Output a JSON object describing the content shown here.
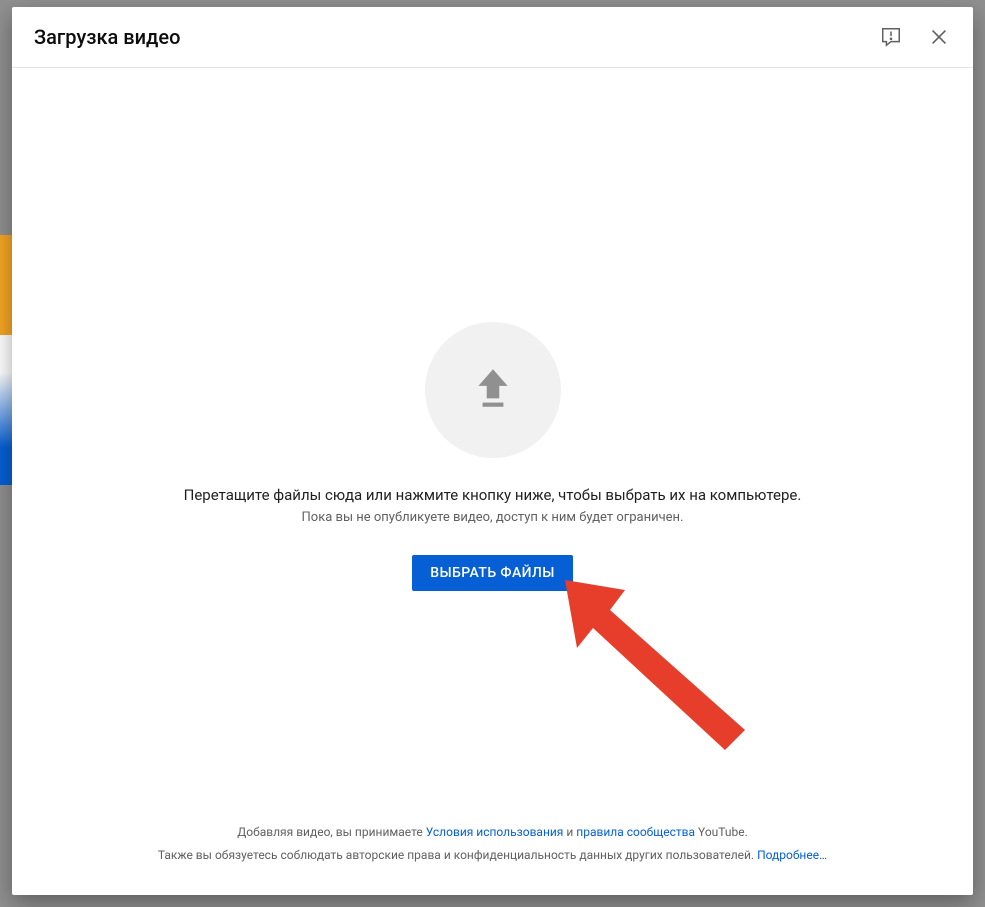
{
  "dialog": {
    "title": "Загрузка видео"
  },
  "upload": {
    "primary_text": "Перетащите файлы сюда или нажмите кнопку ниже, чтобы выбрать их на компьютере.",
    "secondary_text": "Пока вы не опубликуете видео, доступ к ним будет ограничен.",
    "button_label": "ВЫБРАТЬ ФАЙЛЫ"
  },
  "footer": {
    "line1_pre": "Добавляя видео, вы принимаете ",
    "terms_link": "Условия использования",
    "line1_mid": " и ",
    "community_link": "правила сообщества",
    "line1_post": " YouTube.",
    "line2_pre": "Также вы обязуетесь соблюдать авторские права и конфиденциальность данных других пользователей. ",
    "learn_more_link": "Подробнее…"
  }
}
